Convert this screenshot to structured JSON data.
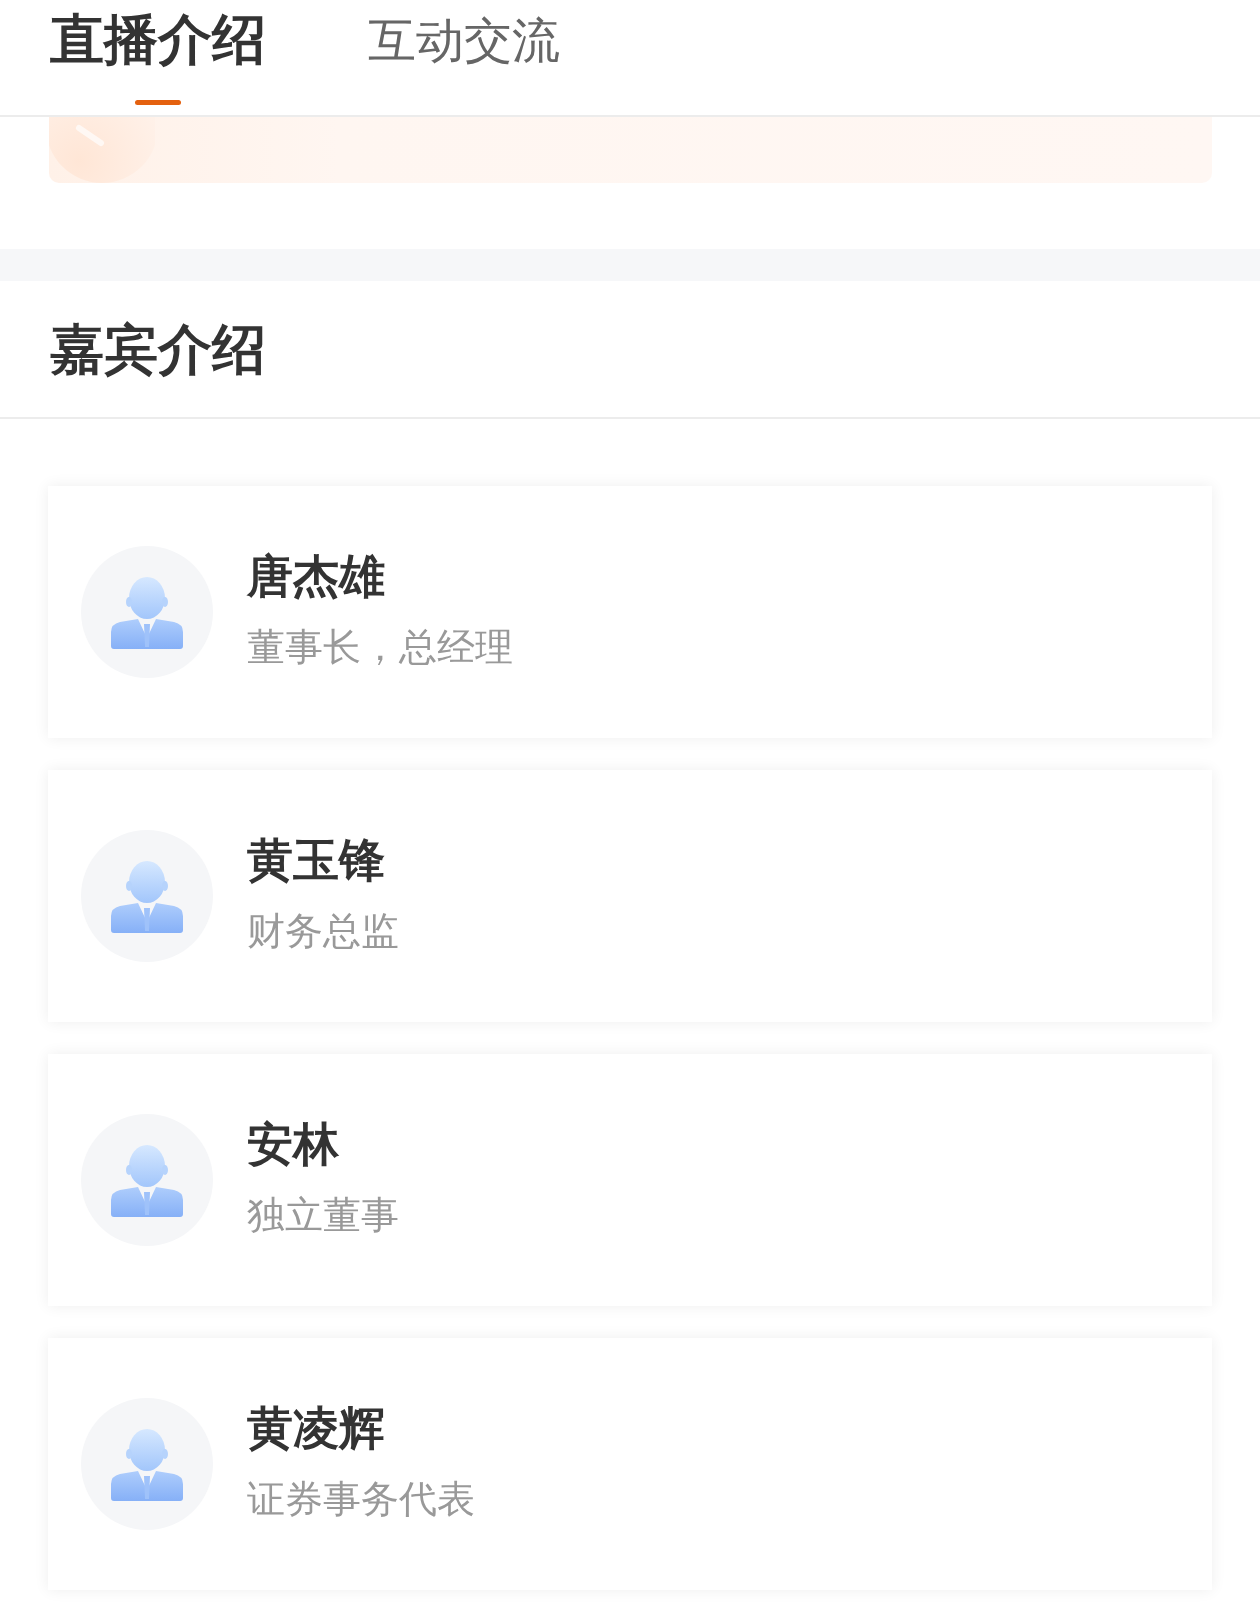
{
  "tabs": [
    {
      "label": "直播介绍",
      "selected": true
    },
    {
      "label": "互动交流",
      "selected": false
    }
  ],
  "guest_section": {
    "title": "嘉宾介绍",
    "guests": [
      {
        "name": "唐杰雄",
        "title": "董事长，总经理"
      },
      {
        "name": "黄玉锋",
        "title": "财务总监"
      },
      {
        "name": "安林",
        "title": "独立董事"
      },
      {
        "name": "黄凌辉",
        "title": "证券事务代表"
      }
    ]
  }
}
